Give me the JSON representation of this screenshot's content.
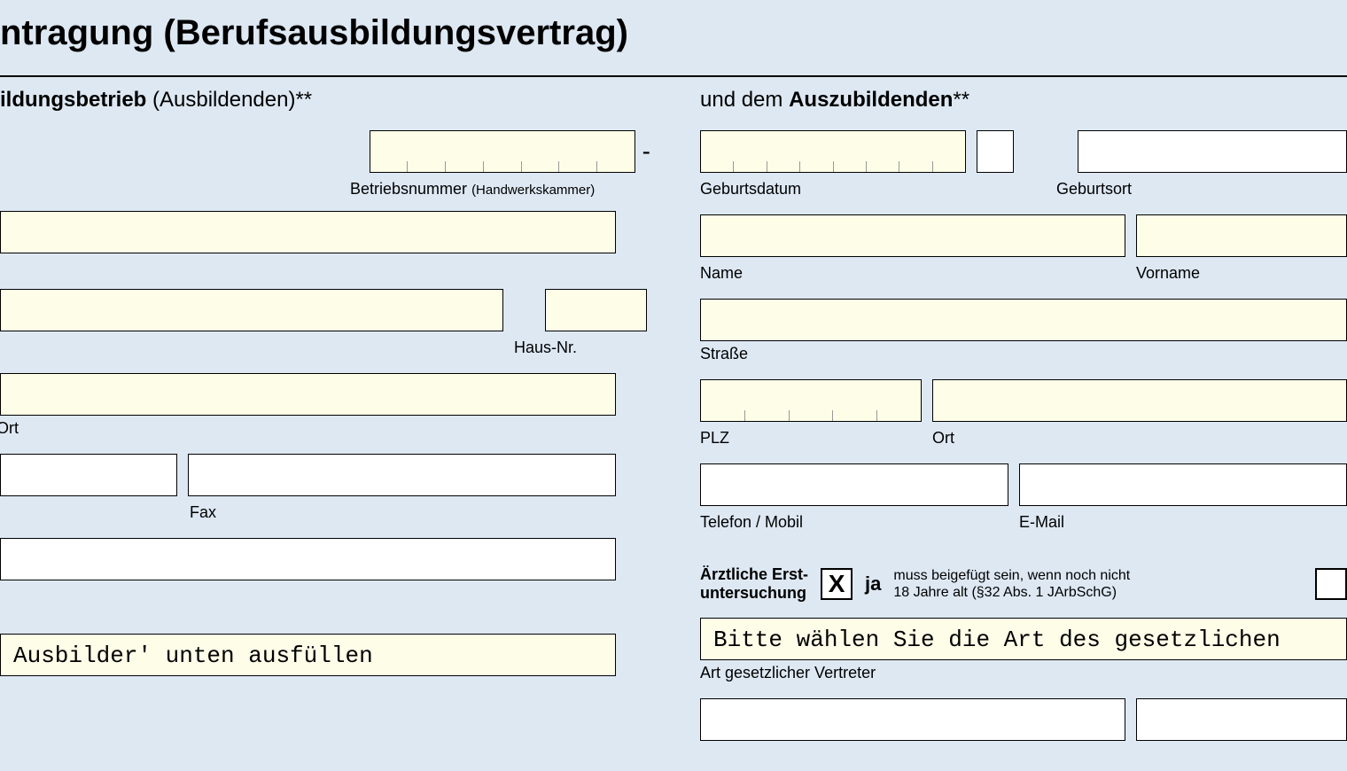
{
  "title": "ntragung (Berufsausbildungsvertrag)",
  "left": {
    "heading_bold": "ildungsbetrieb",
    "heading_rest": " (Ausbildenden)**",
    "betriebsnummer_label": "Betriebsnummer ",
    "betriebsnummer_sub": "(Handwerkskammer)",
    "hausnr_label": "Haus-Nr.",
    "ort_label": "Ort",
    "fax_label": "Fax",
    "ausbilder_value": "Ausbilder' unten ausfüllen",
    "dash": "-"
  },
  "right": {
    "heading_pre": "und dem ",
    "heading_bold": "Auszubildenden",
    "heading_post": "**",
    "geburtsdatum_label": "Geburtsdatum",
    "geburtsort_label": "Geburtsort",
    "name_label": "Name",
    "vorname_label": "Vorname",
    "strasse_label": "Straße",
    "plz_label": "PLZ",
    "ort_label": "Ort",
    "telefon_label": "Telefon / Mobil",
    "email_label": "E-Mail",
    "erstuntersuchung_l1": "Ärztliche Erst-",
    "erstuntersuchung_l2": "untersuchung",
    "ja": "ja",
    "check_mark": "X",
    "note_l1": "muss beigefügt sein, wenn noch nicht",
    "note_l2": "18 Jahre alt (§32 Abs. 1 JArbSchG)",
    "vertreter_value": "Bitte wählen Sie die Art des gesetzlichen",
    "vertreter_label": "Art gesetzlicher Vertreter"
  }
}
